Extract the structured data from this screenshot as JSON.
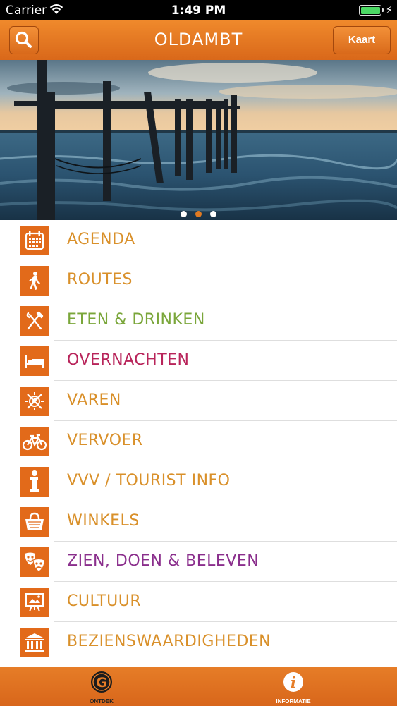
{
  "status_bar": {
    "carrier": "Carrier",
    "time": "1:49 PM"
  },
  "nav": {
    "title": "OLDAMBT",
    "map_button": "Kaart"
  },
  "carousel": {
    "page_count": 3,
    "active_index": 1
  },
  "menu": {
    "items": [
      {
        "label": "AGENDA",
        "icon": "calendar-icon",
        "color": "#d9902a"
      },
      {
        "label": "ROUTES",
        "icon": "walking-icon",
        "color": "#d9902a"
      },
      {
        "label": "ETEN & DRINKEN",
        "icon": "cutlery-icon",
        "color": "#7aa63a"
      },
      {
        "label": "OVERNACHTEN",
        "icon": "bed-icon",
        "color": "#b8245a"
      },
      {
        "label": "VAREN",
        "icon": "compass-icon",
        "color": "#d9902a"
      },
      {
        "label": "VERVOER",
        "icon": "bicycle-icon",
        "color": "#d9902a"
      },
      {
        "label": "VVV / TOURIST INFO",
        "icon": "info-icon",
        "color": "#d9902a"
      },
      {
        "label": "WINKELS",
        "icon": "shopping-bag-icon",
        "color": "#d9902a"
      },
      {
        "label": "ZIEN, DOEN & BELEVEN",
        "icon": "theater-masks-icon",
        "color": "#8a2e8c"
      },
      {
        "label": "CULTUUR",
        "icon": "easel-icon",
        "color": "#d9902a"
      },
      {
        "label": "BEZIENSWAARDIGHEDEN",
        "icon": "museum-icon",
        "color": "#d9902a"
      }
    ]
  },
  "tab_bar": {
    "tabs": [
      {
        "label": "ONTDEK",
        "icon": "g-logo-icon"
      },
      {
        "label": "INFORMATIE",
        "icon": "info-circle-icon"
      }
    ]
  },
  "colors": {
    "brand_orange": "#e26a1a",
    "active_dot": "#e07a22"
  }
}
